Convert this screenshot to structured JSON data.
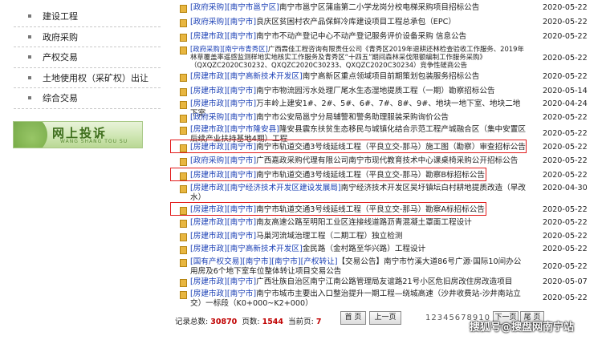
{
  "sidebar": {
    "items": [
      "建设工程",
      "政府采购",
      "产权交易",
      "土地使用权（采矿权）出让",
      "综合交易"
    ],
    "banner_title": "网上投诉",
    "banner_sub": "WANG SHANG TOU SU"
  },
  "rows": [
    {
      "tag": "[政府采购][南宁市邕宁区]",
      "text": "南宁市邕宁区蒲庙第二小学龙岗分校电梯采购项目招标公告",
      "date": "2020-05-22"
    },
    {
      "tag": "[政府采购][南宁市]",
      "text": "良庆区贫困村农产品保鲜冷库建设项目工程总承包（EPC）",
      "date": "2020-05-22"
    },
    {
      "tag": "[房建市政][南宁市]",
      "text": "南宁市不动产登记中心不动产登记服务评价设备采购 信息公告",
      "date": "2020-05-22"
    },
    {
      "tag": "[政府采购][南宁市青秀区]",
      "text": "广西霖佳工程咨询有限责任公司《青秀区2019年退耕还林检查验收工作服务、2019年林草覆盖率遥感监测样地实地核实工作服务及青秀区“十四五”期间森林采伐限额编制工作服务采购》（QXQZC2020C30232、QXQZC2020C30233、QXQZC2020C30234）竞争性磋商公告",
      "date": "2020-05-22"
    },
    {
      "tag": "[房建市政][南宁高新技术开发区]",
      "text": "南宁高新区重点领域项目前期策划包装服务招标公告",
      "date": "2020-05-22"
    },
    {
      "tag": "[房建市政][南宁市]",
      "text": "南宁市物流园污水处理厂尾水生态湿地提质工程（一期）勘察招标公告",
      "date": "2020-05-14"
    },
    {
      "tag": "[房建市政][南宁市]",
      "text": "万丰岭上建安1#、2#、5#、6#、7#、8#、9#、地块一地下室、地块二地下室",
      "date": "2020-04-24"
    },
    {
      "tag": "[政府采购][南宁市]",
      "text": "南宁市公安局邕宁分局辅警和警务助理服装采购询价公告",
      "date": "2020-05-22"
    },
    {
      "tag": "[房建市政][南宁市隆安县]",
      "text": "隆安县震东扶贫生态移民与城镇化结合示范工程产城融合区（集中安置区后续产业扶持基地4期）工程",
      "date": "2020-05-22"
    },
    {
      "tag": "[房建市政][南宁市]",
      "text": "南宁市轨道交通3号线延线工程（平良立交-那马）施工图（勘察）审查招标公告",
      "date": "2020-05-22"
    },
    {
      "tag": "[政府采购][南宁市]",
      "text": "广西嘉政采购代理有限公司南宁市现代教育技术中心课桌椅采购公开招标公告",
      "date": "2020-05-22"
    },
    {
      "tag": "[房建市政][南宁市]",
      "text": "南宁市轨道交通3号线延线工程（平良立交-那马）勘察B标招标公告",
      "date": "2020-05-22"
    },
    {
      "tag": "[房建市政][南宁经济技术开发区建设发展局]",
      "text": "南宁经济技术开发区吴圩镇坛白村耕地提质改造（旱改水）",
      "date": "2020-04-30"
    },
    {
      "tag": "[房建市政][南宁市]",
      "text": "南宁市轨道交通3号线延线工程（平良立交-那马）勘察A标招标公告",
      "date": "2020-05-22"
    },
    {
      "tag": "[房建市政][南宁市]",
      "text": "南友高速公路至明阳工业区连接线道路沥青混凝土罩面工程设计",
      "date": "2020-05-22"
    },
    {
      "tag": "[房建市政][南宁市]",
      "text": "马巢河流域治理工程（二期工程）独立检测",
      "date": "2020-05-22"
    },
    {
      "tag": "[房建市政][南宁高新技术开发区]",
      "text": "金民路（金村路至华兴路）工程设计",
      "date": "2020-05-22"
    },
    {
      "tag": "[国有产权交易][南宁市][南宁市][产权转让]",
      "text": "【交易公告】南宁市竹溪大道86号广源·国际10间办公用房及6个地下室车位整体转让项目交易公告",
      "date": "2020-05-22"
    },
    {
      "tag": "[房建市政][南宁市]",
      "text": "广西壮族自治区南宁江南公路管理局友谊路21号小区危旧房改住房改造项目",
      "date": "2020-05-07"
    },
    {
      "tag": "[房建市政][南宁市]",
      "text": "南宁市城市主要出入口整治提升一期工程—绕城高速（沙井收费站-沙井南站立交）一标段（K0+000~K2+000）",
      "date": "2020-05-22"
    }
  ],
  "pager": {
    "total_label": "记录总数:",
    "total": "30870",
    "pages_label": "页数:",
    "pages": "1544",
    "current_label": "当前页:",
    "current": "7",
    "first": "首 页",
    "prev": "上一页",
    "pages_strip": "12345678910",
    "next": "下一页",
    "last": "尾 页"
  },
  "watermark": "搜狐号@搜盘网南宁站",
  "colors": {
    "tag": "#1a3fb5",
    "highlight": "#e21b1b",
    "count": "#c00000"
  }
}
